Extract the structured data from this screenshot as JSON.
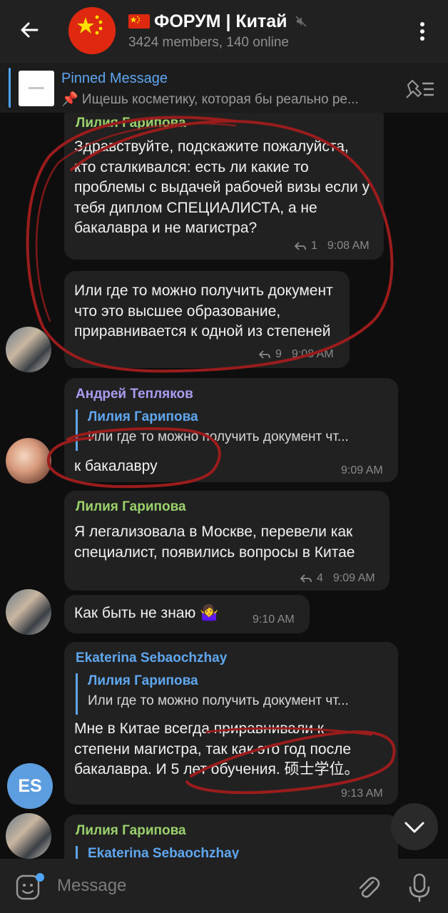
{
  "header": {
    "title_flag_emoji": "🇨🇳",
    "title": "ФОРУМ | Китай",
    "subtitle": "3424 members, 140 online"
  },
  "pinned": {
    "label": "Pinned Message",
    "text": "📌 Ищешь косметику, которая бы реально ре..."
  },
  "messages": [
    {
      "sender": "Лилия Гарипова",
      "text": "Здравствуйте, подскажите пожалуйста, кто сталкивался: есть ли какие то проблемы с выдачей рабочей визы если у тебя диплом СПЕЦИАЛИСТА, а не бакалавра и не магистра?",
      "replies": "1",
      "time": "9:08 AM"
    },
    {
      "text": "Или где то можно получить документ что это высшее образование, приравнивается к одной из степеней",
      "replies": "9",
      "time": "9:08 AM"
    },
    {
      "sender": "Андрей Тепляков",
      "quote_name": "Лилия Гарипова",
      "quote_text": "Или где то можно получить документ чт...",
      "text": "к бакалавру",
      "time": "9:09 AM"
    },
    {
      "sender": "Лилия Гарипова",
      "text": "Я легализовала в Москве, перевели как специалист, появились вопросы в Китае",
      "replies": "4",
      "time": "9:09 AM"
    },
    {
      "text": "Как быть не знаю 🤷‍♀️",
      "time": "9:10 AM"
    },
    {
      "sender": "Ekaterina Sebaochzhay",
      "quote_name": "Лилия Гарипова",
      "quote_text": "Или где то можно получить документ чт...",
      "text": "Мне в Китае всегда приравнивали к степени магистра, так как это год после бакалавра. И 5 лет обучения. 硕士学位。",
      "time": "9:13 AM"
    },
    {
      "sender": "Лилия Гарипова",
      "quote_name": "Ekaterina Sebaochzhay"
    }
  ],
  "avatars": {
    "es_initials": "ES"
  },
  "composer": {
    "placeholder": "Message"
  },
  "colors": {
    "name_green": "#9ad26b",
    "name_violet": "#a99cf2",
    "name_blue": "#5fa7f0",
    "annotation_red": "#9b1c1c"
  }
}
